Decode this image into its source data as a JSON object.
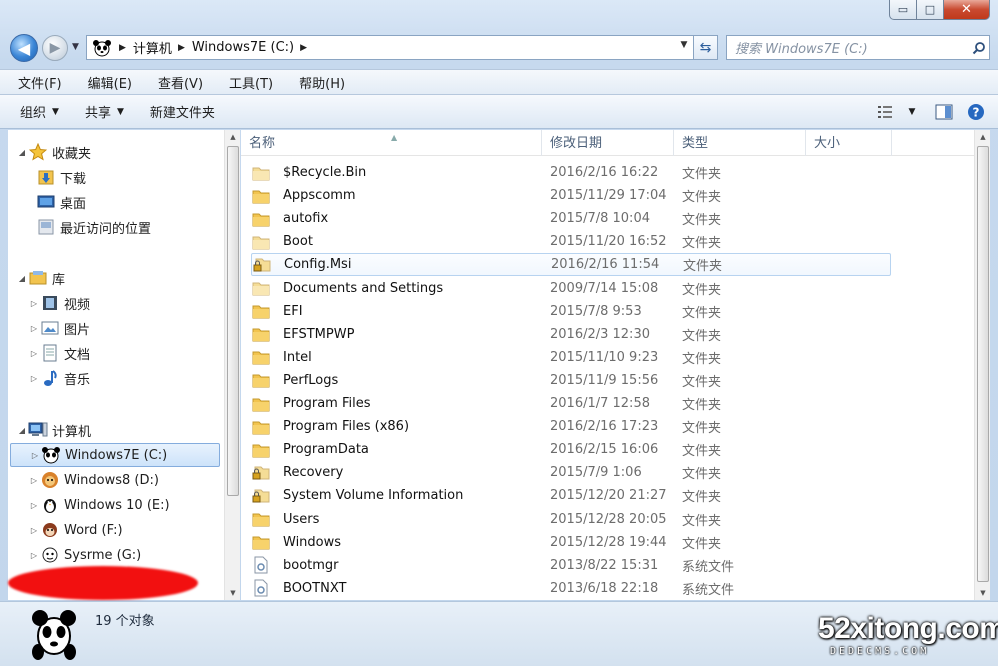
{
  "window": {
    "caption_buttons": {
      "minimize": "▭",
      "maximize": "□",
      "close": "✕"
    }
  },
  "nav": {
    "back_glyph": "◀",
    "forward_glyph": "▶",
    "breadcrumbs": [
      "计算机",
      "Windows7E (C:)"
    ],
    "search_placeholder": "搜索 Windows7E (C:)"
  },
  "menubar": [
    "文件(F)",
    "编辑(E)",
    "查看(V)",
    "工具(T)",
    "帮助(H)"
  ],
  "commandbar": {
    "organize": "组织",
    "share": "共享",
    "new_folder": "新建文件夹"
  },
  "navpane": {
    "favorites": {
      "label": "收藏夹",
      "items": [
        "下载",
        "桌面",
        "最近访问的位置"
      ]
    },
    "libraries": {
      "label": "库",
      "items": [
        "视频",
        "图片",
        "文档",
        "音乐"
      ]
    },
    "computer": {
      "label": "计算机",
      "items": [
        "Windows7E (C:)",
        "Windows8 (D:)",
        "Windows 10 (E:)",
        "Word (F:)",
        "Sysrme (G:)"
      ],
      "selected": "Windows7E (C:)"
    }
  },
  "columns": {
    "name": "名称",
    "date": "修改日期",
    "type": "类型",
    "size": "大小"
  },
  "files": [
    {
      "name": "$Recycle.Bin",
      "date": "2016/2/16 16:22",
      "type": "文件夹",
      "icon": "folder-system-icon"
    },
    {
      "name": "Appscomm",
      "date": "2015/11/29 17:04",
      "type": "文件夹",
      "icon": "folder-icon"
    },
    {
      "name": "autofix",
      "date": "2015/7/8 10:04",
      "type": "文件夹",
      "icon": "folder-icon"
    },
    {
      "name": "Boot",
      "date": "2015/11/20 16:52",
      "type": "文件夹",
      "icon": "folder-system-icon"
    },
    {
      "name": "Config.Msi",
      "date": "2016/2/16 11:54",
      "type": "文件夹",
      "icon": "folder-locked-icon"
    },
    {
      "name": "Documents and Settings",
      "date": "2009/7/14 15:08",
      "type": "文件夹",
      "icon": "folder-link-icon"
    },
    {
      "name": "EFI",
      "date": "2015/7/8 9:53",
      "type": "文件夹",
      "icon": "folder-icon"
    },
    {
      "name": "EFSTMPWP",
      "date": "2016/2/3 12:30",
      "type": "文件夹",
      "icon": "folder-icon"
    },
    {
      "name": "Intel",
      "date": "2015/11/10 9:23",
      "type": "文件夹",
      "icon": "folder-icon"
    },
    {
      "name": "PerfLogs",
      "date": "2015/11/9 15:56",
      "type": "文件夹",
      "icon": "folder-icon"
    },
    {
      "name": "Program Files",
      "date": "2016/1/7 12:58",
      "type": "文件夹",
      "icon": "folder-icon"
    },
    {
      "name": "Program Files (x86)",
      "date": "2016/2/16 17:23",
      "type": "文件夹",
      "icon": "folder-icon"
    },
    {
      "name": "ProgramData",
      "date": "2016/2/15 16:06",
      "type": "文件夹",
      "icon": "folder-icon"
    },
    {
      "name": "Recovery",
      "date": "2015/7/9 1:06",
      "type": "文件夹",
      "icon": "folder-locked-icon"
    },
    {
      "name": "System Volume Information",
      "date": "2015/12/20 21:27",
      "type": "文件夹",
      "icon": "folder-locked-icon"
    },
    {
      "name": "Users",
      "date": "2015/12/28 20:05",
      "type": "文件夹",
      "icon": "folder-icon"
    },
    {
      "name": "Windows",
      "date": "2015/12/28 19:44",
      "type": "文件夹",
      "icon": "folder-icon"
    },
    {
      "name": "bootmgr",
      "date": "2013/8/22 15:31",
      "type": "系统文件",
      "icon": "system-file-icon"
    },
    {
      "name": "BOOTNXT",
      "date": "2013/6/18 22:18",
      "type": "系统文件",
      "icon": "system-file-icon"
    }
  ],
  "hovered_file": "Config.Msi",
  "details": {
    "count_text": "19 个对象"
  },
  "watermark": {
    "main": "52xitong.com",
    "sub": "DEDECMS.COM"
  },
  "colors": {
    "accent": "#3b86d6",
    "selection": "#cde3fa",
    "folder": "#f2c44f",
    "redaction": "#f21010"
  }
}
